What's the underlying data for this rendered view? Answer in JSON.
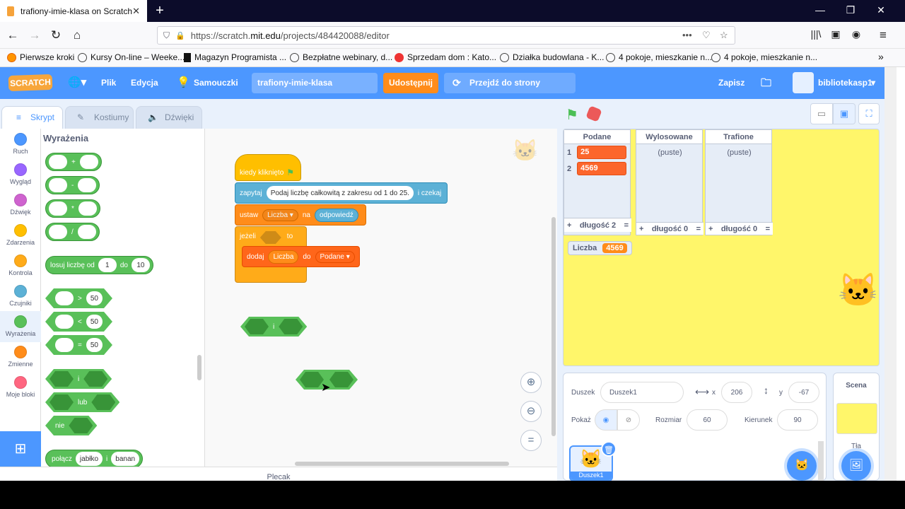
{
  "browser": {
    "tab_title": "trafiony-imie-klasa on Scratch",
    "tab_close": "✕",
    "new_tab": "+",
    "url_prefix": "https://scratch.",
    "url_domain": "mit.edu",
    "url_suffix": "/projects/484420088/editor",
    "bookmarks": [
      "Pierwsze kroki",
      "Kursy On-line – Weeke...",
      "Magazyn Programista ...",
      "Bezpłatne webinary, d...",
      "Sprzedam dom : Kato...",
      "Działka budowlana - K...",
      "4 pokoje, mieszkanie n...",
      "4 pokoje, mieszkanie n..."
    ]
  },
  "menu": {
    "logo": "SCRATCH",
    "file": "Plik",
    "edit": "Edycja",
    "tutorials": "Samouczki",
    "project_title": "trafiony-imie-klasa",
    "share": "Udostępnij",
    "see_project": "Przejdź do strony projektu",
    "save": "Zapisz",
    "username": "bibliotekasp1"
  },
  "tabs": {
    "code": "Skrypt",
    "costumes": "Kostiumy",
    "sounds": "Dźwięki"
  },
  "categories": [
    {
      "label": "Ruch",
      "color": "#4c97ff"
    },
    {
      "label": "Wygląd",
      "color": "#9966ff"
    },
    {
      "label": "Dźwięk",
      "color": "#cf63cf"
    },
    {
      "label": "Zdarzenia",
      "color": "#ffbf00"
    },
    {
      "label": "Kontrola",
      "color": "#ffab19"
    },
    {
      "label": "Czujniki",
      "color": "#5cb1d6"
    },
    {
      "label": "Wyrażenia",
      "color": "#59c059"
    },
    {
      "label": "Zmienne",
      "color": "#ff8c1a"
    },
    {
      "label": "Moje bloki",
      "color": "#ff6680"
    }
  ],
  "palette": {
    "title": "Wyrażenia",
    "ops": [
      "+",
      "-",
      "*",
      "/"
    ],
    "random": {
      "label": "losuj liczbę od",
      "from": "1",
      "to_label": "do",
      "to": "10"
    },
    "compare": [
      {
        "op": ">",
        "val": "50"
      },
      {
        "op": "<",
        "val": "50"
      },
      {
        "op": "=",
        "val": "50"
      }
    ],
    "and": "i",
    "or": "lub",
    "not": "nie",
    "join": {
      "label": "połącz",
      "a": "jabłko",
      "mid": "i",
      "b": "banan"
    }
  },
  "script": {
    "hat": "kiedy kliknięto",
    "ask_label": "zapytaj",
    "ask_text": "Podaj liczbę całkowitą z zakresu od 1 do 25.",
    "ask_wait": "i czekaj",
    "set_label": "ustaw",
    "set_var": "Liczba",
    "set_to": "na",
    "answer": "odpowiedź",
    "if_label": "jeżeli",
    "if_then": "to",
    "add_label": "dodaj",
    "add_var": "Liczba",
    "add_to": "do",
    "add_list": "Podane",
    "loose_and": "i"
  },
  "stage": {
    "lists": [
      {
        "name": "Podane",
        "items": [
          "25",
          "4569"
        ],
        "length_label": "długość 2"
      },
      {
        "name": "Wylosowane",
        "empty": "(puste)",
        "length_label": "długość 0"
      },
      {
        "name": "Trafione",
        "empty": "(puste)",
        "length_label": "długość 0"
      }
    ],
    "variable": {
      "name": "Liczba",
      "value": "4569"
    }
  },
  "sprite": {
    "label": "Duszek",
    "name": "Duszek1",
    "x_label": "x",
    "x": "206",
    "y_label": "y",
    "y": "-67",
    "show_label": "Pokaż",
    "size_label": "Rozmiar",
    "size": "60",
    "direction_label": "Kierunek",
    "direction": "90",
    "thumb_label": "Duszek1"
  },
  "stage_panel": {
    "title": "Scena",
    "backdrops": "Tła"
  },
  "footer": {
    "backpack": "Plecak"
  }
}
